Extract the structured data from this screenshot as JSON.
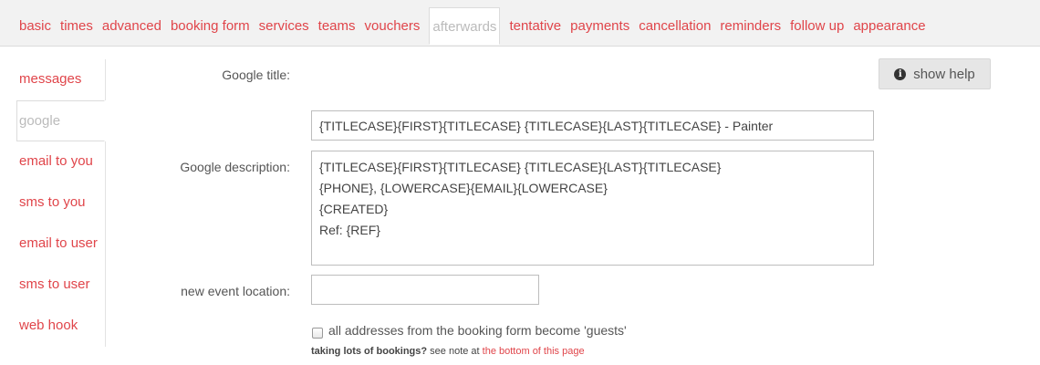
{
  "tabs": [
    {
      "label": "basic"
    },
    {
      "label": "times"
    },
    {
      "label": "advanced"
    },
    {
      "label": "booking form"
    },
    {
      "label": "services"
    },
    {
      "label": "teams"
    },
    {
      "label": "vouchers"
    },
    {
      "label": "afterwards",
      "active": true
    },
    {
      "label": "tentative"
    },
    {
      "label": "payments"
    },
    {
      "label": "cancellation"
    },
    {
      "label": "reminders"
    },
    {
      "label": "follow up"
    },
    {
      "label": "appearance"
    }
  ],
  "sidebar": {
    "items": [
      {
        "label": "messages"
      },
      {
        "label": "google",
        "active": true
      },
      {
        "label": "email to you"
      },
      {
        "label": "sms to you"
      },
      {
        "label": "email to user"
      },
      {
        "label": "sms to user"
      },
      {
        "label": "web hook"
      }
    ]
  },
  "form": {
    "google_title_label": "Google title:",
    "google_title_value": "{TITLECASE}{FIRST}{TITLECASE} {TITLECASE}{LAST}{TITLECASE} - Painter",
    "google_description_label": "Google description:",
    "google_description_value": "{TITLECASE}{FIRST}{TITLECASE} {TITLECASE}{LAST}{TITLECASE}\n{PHONE}, {LOWERCASE}{EMAIL}{LOWERCASE}\n{CREATED}\nRef: {REF}",
    "event_location_label": "new event location:",
    "event_location_value": "",
    "guests_checkbox_label": "all addresses from the booking form become 'guests'",
    "guests_checked": false,
    "note_bold": "taking lots of bookings?",
    "note_text": " see note at ",
    "note_link": "the bottom of this page"
  },
  "help": {
    "label": "show help",
    "icon": "info-icon"
  }
}
